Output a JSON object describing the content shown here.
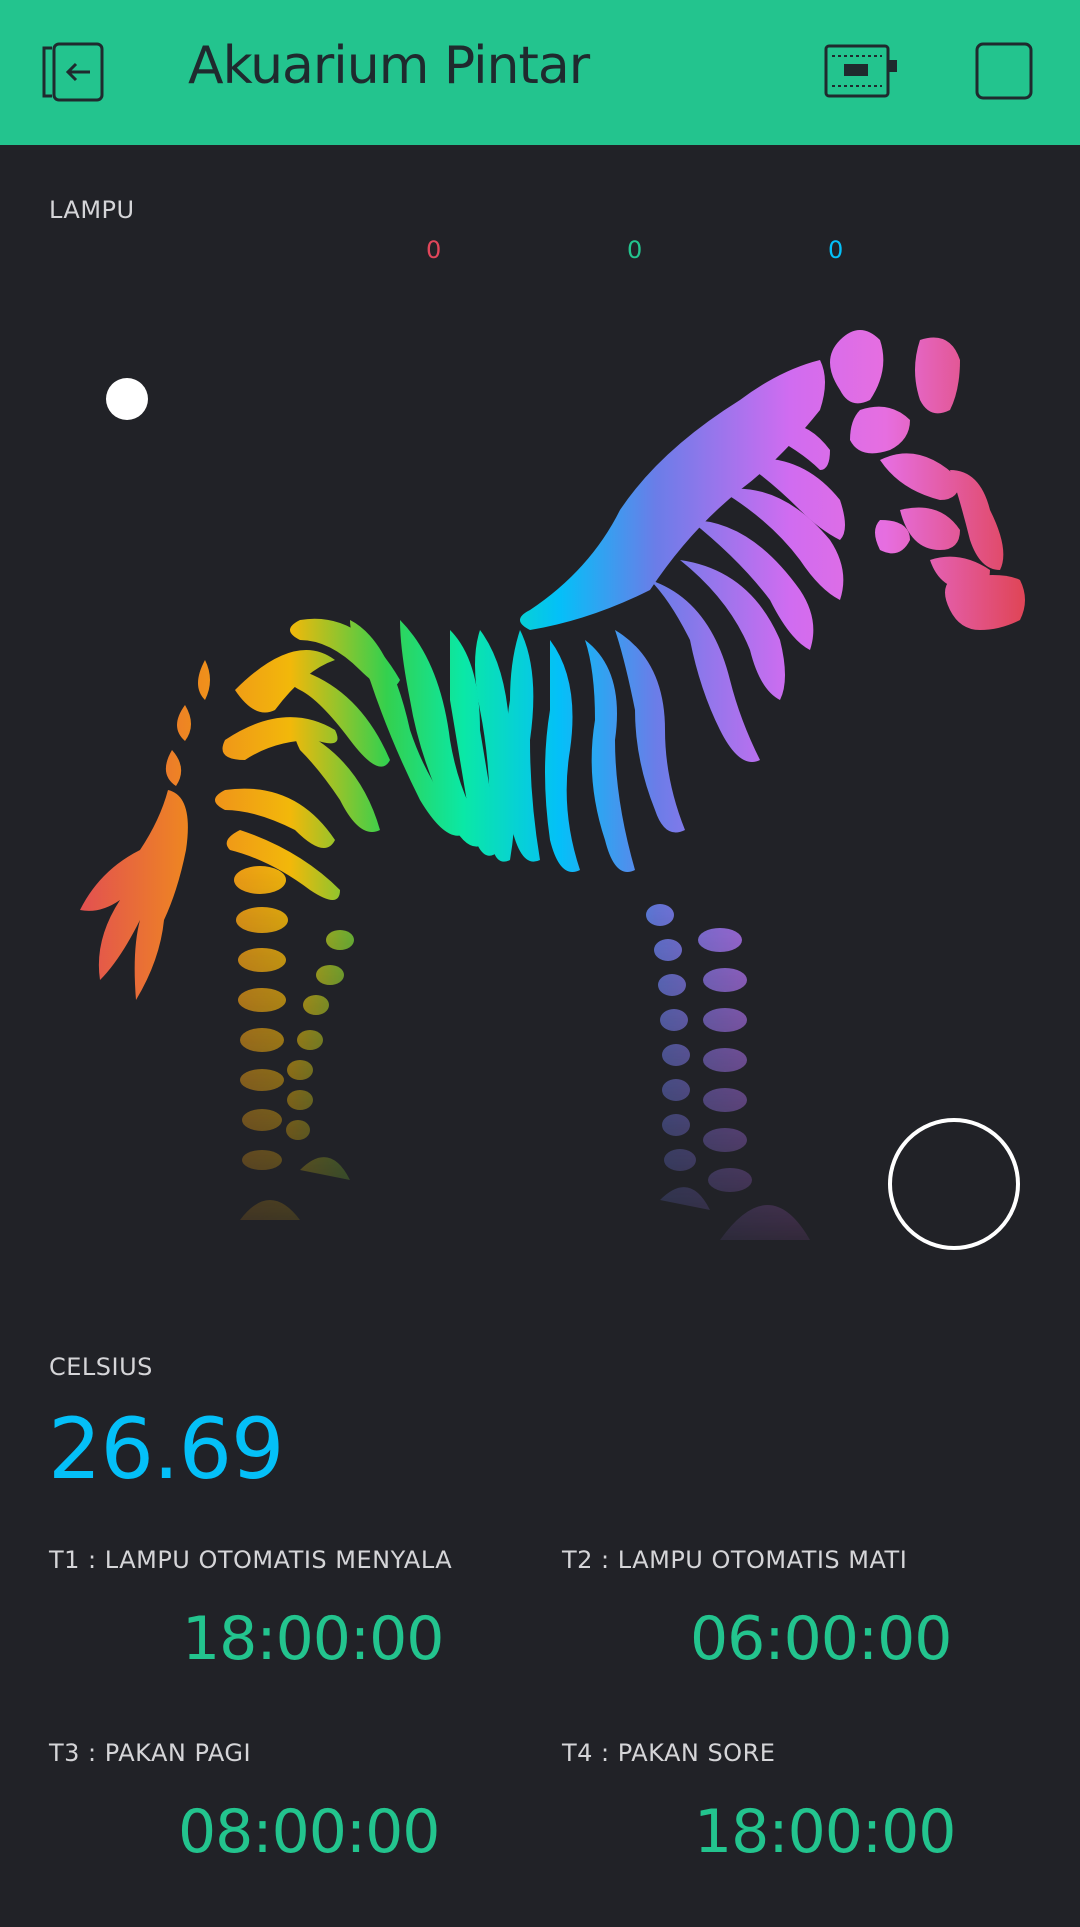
{
  "header": {
    "title": "Akuarium Pintar",
    "bg_color": "#23c48e"
  },
  "lampu": {
    "label": "LAMPU",
    "r": "0",
    "g": "0",
    "b": "0",
    "r_color": "#e0465a",
    "g_color": "#23c48e",
    "b_color": "#04c0f8"
  },
  "celsius": {
    "label": "CELSIUS",
    "value": "26.69",
    "color": "#04c0f8"
  },
  "timers": [
    {
      "label": "T1 : LAMPU OTOMATIS MENYALA",
      "value": "18:00:00"
    },
    {
      "label": "T2 : LAMPU OTOMATIS MATI",
      "value": "06:00:00"
    },
    {
      "label": "T3 : PAKAN PAGI",
      "value": "08:00:00"
    },
    {
      "label": "T4 : PAKAN SORE",
      "value": "18:00:00"
    }
  ],
  "icons": {
    "back": "exit-icon",
    "device": "device-status-icon",
    "play": "play-stop-icon",
    "picker": "zebra-color-wheel-icon"
  }
}
